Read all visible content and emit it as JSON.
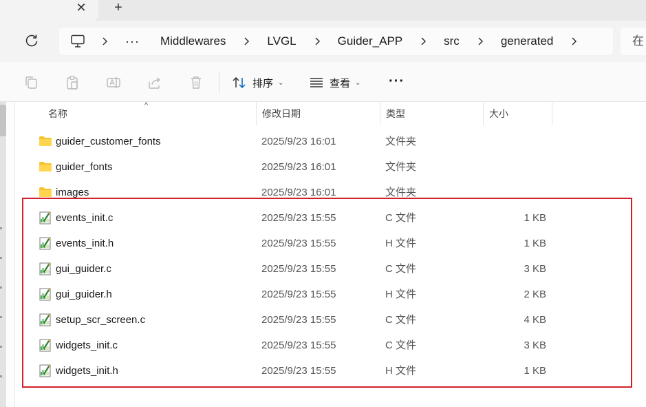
{
  "tabbar": {
    "close_glyph": "✕",
    "new_tab_glyph": "+"
  },
  "breadcrumb": {
    "overflow": "···",
    "items": [
      "Middlewares",
      "LVGL",
      "Guider_APP",
      "src",
      "generated"
    ]
  },
  "search": {
    "partial_text": "在"
  },
  "toolbar": {
    "sort_label": "排序",
    "view_label": "查看",
    "more_glyph": "···"
  },
  "columns": {
    "name": "名称",
    "date": "修改日期",
    "type": "类型",
    "size": "大小"
  },
  "files": [
    {
      "name": "guider_customer_fonts",
      "date": "2025/9/23 16:01",
      "type": "文件夹",
      "size": "",
      "kind": "folder"
    },
    {
      "name": "guider_fonts",
      "date": "2025/9/23 16:01",
      "type": "文件夹",
      "size": "",
      "kind": "folder"
    },
    {
      "name": "images",
      "date": "2025/9/23 16:01",
      "type": "文件夹",
      "size": "",
      "kind": "folder"
    },
    {
      "name": "events_init.c",
      "date": "2025/9/23 15:55",
      "type": "C 文件",
      "size": "1 KB",
      "kind": "source"
    },
    {
      "name": "events_init.h",
      "date": "2025/9/23 15:55",
      "type": "H 文件",
      "size": "1 KB",
      "kind": "source"
    },
    {
      "name": "gui_guider.c",
      "date": "2025/9/23 15:55",
      "type": "C 文件",
      "size": "3 KB",
      "kind": "source"
    },
    {
      "name": "gui_guider.h",
      "date": "2025/9/23 15:55",
      "type": "H 文件",
      "size": "2 KB",
      "kind": "source"
    },
    {
      "name": "setup_scr_screen.c",
      "date": "2025/9/23 15:55",
      "type": "C 文件",
      "size": "4 KB",
      "kind": "source"
    },
    {
      "name": "widgets_init.c",
      "date": "2025/9/23 15:55",
      "type": "C 文件",
      "size": "3 KB",
      "kind": "source"
    },
    {
      "name": "widgets_init.h",
      "date": "2025/9/23 15:55",
      "type": "H 文件",
      "size": "1 KB",
      "kind": "source"
    }
  ],
  "colors": {
    "highlight": "#d21f2b",
    "folder": "#f4c430",
    "accent": "#0067c0"
  }
}
